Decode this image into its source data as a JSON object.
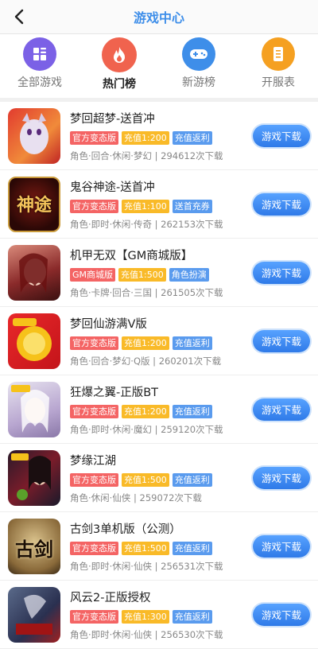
{
  "header": {
    "title": "游戏中心",
    "back_icon": "chevron-left-icon"
  },
  "tabs": [
    {
      "label": "全部游戏",
      "icon": "grid-icon",
      "color": "#7b61e6",
      "active": false
    },
    {
      "label": "热门榜",
      "icon": "flame-icon",
      "color": "#f0634e",
      "active": true
    },
    {
      "label": "新游榜",
      "icon": "gamepad-icon",
      "color": "#3e8ee9",
      "active": false
    },
    {
      "label": "开服表",
      "icon": "document-icon",
      "color": "#f5a021",
      "active": false
    }
  ],
  "games": [
    {
      "name": "梦回超梦-送首冲",
      "tags": [
        "官方变态版",
        "充值1:200",
        "充值返利"
      ],
      "meta": "角色·回合·休闲·梦幻 | 294612次下载",
      "button": "游戏下载",
      "thumb_text": ""
    },
    {
      "name": "鬼谷神途-送首冲",
      "tags": [
        "官方变态版",
        "充值1:100",
        "送首充券"
      ],
      "meta": "角色·即时·休闲·传奇 | 262153次下载",
      "button": "游戏下载",
      "thumb_text": "神途"
    },
    {
      "name": "机甲无双【GM商城版】",
      "tags": [
        "GM商城版",
        "充值1:500",
        "角色扮演"
      ],
      "meta": "角色·卡牌·回合·三国 | 261505次下载",
      "button": "游戏下载",
      "thumb_text": ""
    },
    {
      "name": "梦回仙游满V版",
      "tags": [
        "官方变态版",
        "充值1:200",
        "充值返利"
      ],
      "meta": "角色·回合·梦幻·Q版 | 260201次下载",
      "button": "游戏下载",
      "thumb_text": ""
    },
    {
      "name": "狂爆之翼-正版BT",
      "tags": [
        "官方变态版",
        "充值1:200",
        "充值返利"
      ],
      "meta": "角色·即时·休闲·魔幻 | 259120次下载",
      "button": "游戏下载",
      "thumb_text": ""
    },
    {
      "name": "梦缘江湖",
      "tags": [
        "官方变态版",
        "充值1:500",
        "充值返利"
      ],
      "meta": "角色·休闲·仙侠 | 259072次下载",
      "button": "游戏下载",
      "thumb_text": ""
    },
    {
      "name": "古剑3单机版（公测）",
      "tags": [
        "官方变态版",
        "充值1:500",
        "充值返利"
      ],
      "meta": "角色·即时·休闲·仙侠 | 256531次下载",
      "button": "游戏下载",
      "thumb_text": "古剑"
    },
    {
      "name": "风云2-正版授权",
      "tags": [
        "官方变态版",
        "充值1:300",
        "充值返利"
      ],
      "meta": "角色·即时·休闲·仙侠 | 256530次下载",
      "button": "游戏下载",
      "thumb_text": ""
    }
  ],
  "tag_colors": {
    "red": "#f46464",
    "yellow": "#f9ba28",
    "blue": "#5a9bee"
  }
}
